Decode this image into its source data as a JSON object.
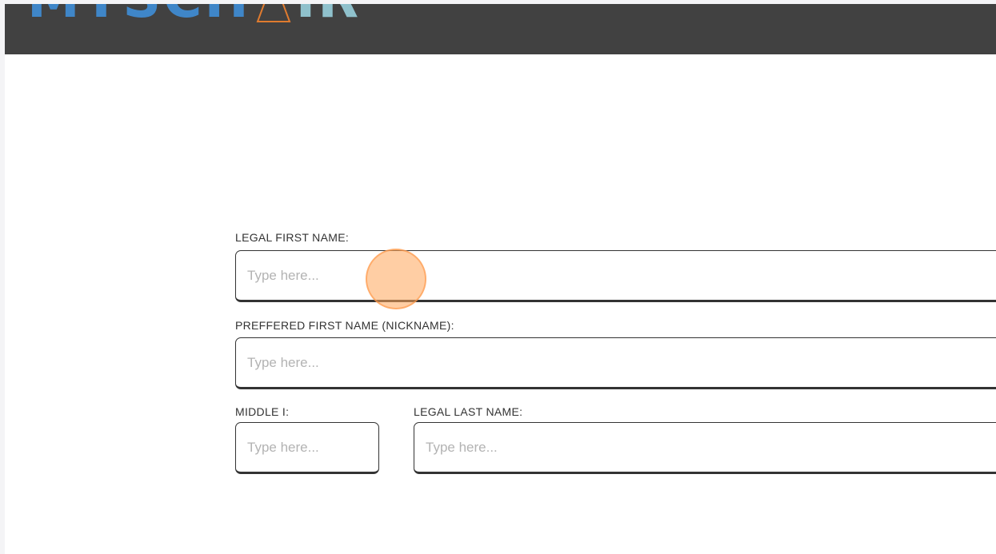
{
  "header": {
    "logo_text_part1": "MYSCH",
    "logo_text_part3": "IR",
    "logo_triangle_color": "#e07b2f",
    "background_color": "#414141"
  },
  "form": {
    "legal_first_name": {
      "label": "LEGAL FIRST NAME:",
      "placeholder": "Type here...",
      "value": ""
    },
    "preferred_first_name": {
      "label": "PREFFERED FIRST NAME (NICKNAME):",
      "placeholder": "Type here...",
      "value": ""
    },
    "middle_initial": {
      "label": "MIDDLE I:",
      "placeholder": "Type here...",
      "value": ""
    },
    "legal_last_name": {
      "label": "LEGAL LAST NAME:",
      "placeholder": "Type here...",
      "value": ""
    }
  },
  "colors": {
    "accent_click": "#ffa55a",
    "border": "#333333",
    "placeholder": "#b3b3b3"
  }
}
